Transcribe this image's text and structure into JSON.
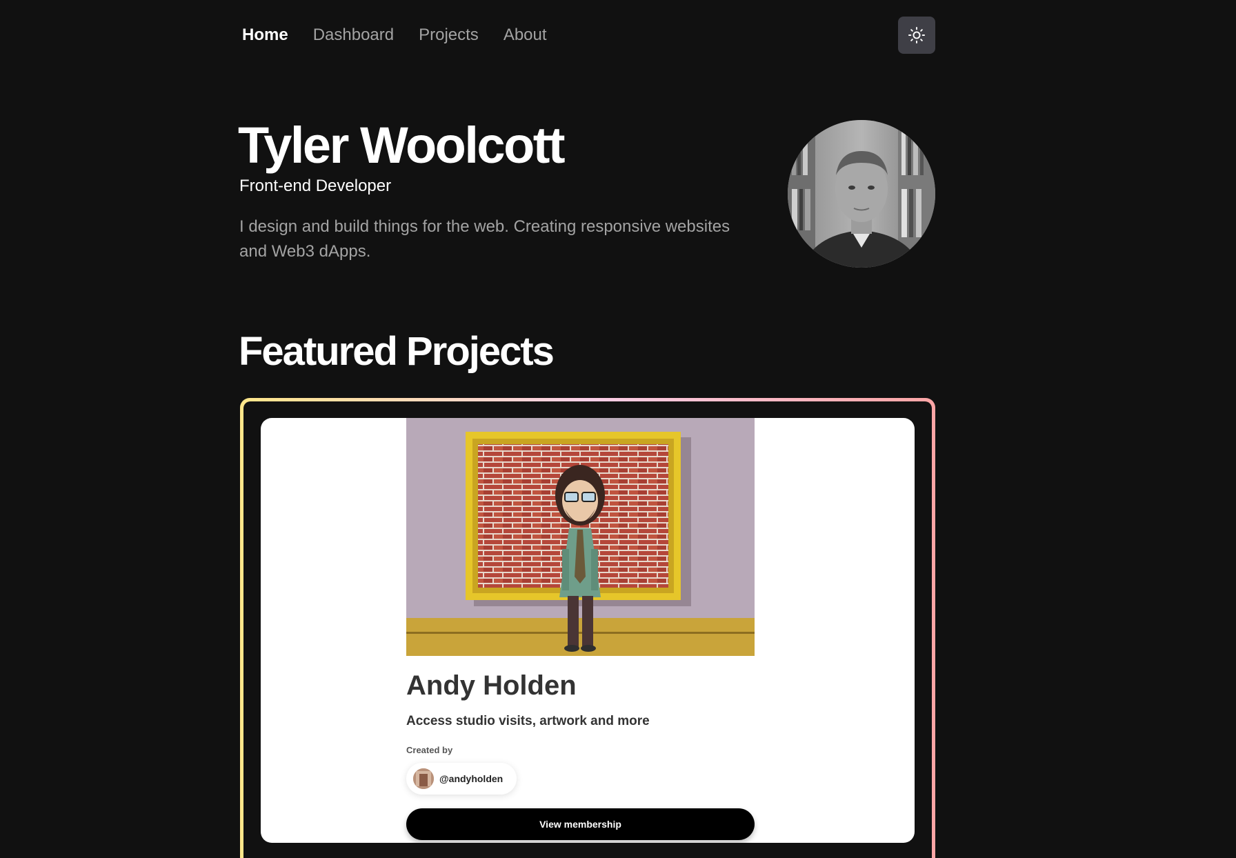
{
  "nav": {
    "items": [
      {
        "label": "Home",
        "active": true
      },
      {
        "label": "Dashboard",
        "active": false
      },
      {
        "label": "Projects",
        "active": false
      },
      {
        "label": "About",
        "active": false
      }
    ],
    "theme_toggle_icon": "sun-icon"
  },
  "hero": {
    "name": "Tyler Woolcott",
    "role": "Front-end Developer",
    "bio": "I design and build things for the web. Creating responsive websites and Web3 dApps.",
    "avatar_icon": "profile-photo"
  },
  "featured": {
    "title": "Featured Projects",
    "project": {
      "title": "Andy Holden",
      "subtitle": "Access studio visits, artwork and more",
      "created_by_label": "Created by",
      "creator_handle": "@andyholden",
      "cta_label": "View membership",
      "border_colors": [
        "#fde68a",
        "#fbcfe8",
        "#fca5a5"
      ]
    }
  },
  "colors": {
    "background": "#111111",
    "muted_text": "#a3a3a3",
    "theme_button": "#3f3f46"
  }
}
